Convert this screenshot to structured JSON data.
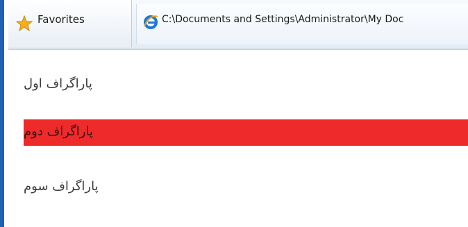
{
  "toolbar": {
    "favorites_label": "Favorites",
    "tab_title": "C:\\Documents and Settings\\Administrator\\My Doc"
  },
  "icons": {
    "favorites": "star-icon",
    "tab": "ie-icon"
  },
  "content": {
    "paragraphs": [
      "پاراگراف اول",
      "پاراگراف دوم",
      "پاراگراف سوم"
    ],
    "highlight_color": "#ee2a2a"
  }
}
